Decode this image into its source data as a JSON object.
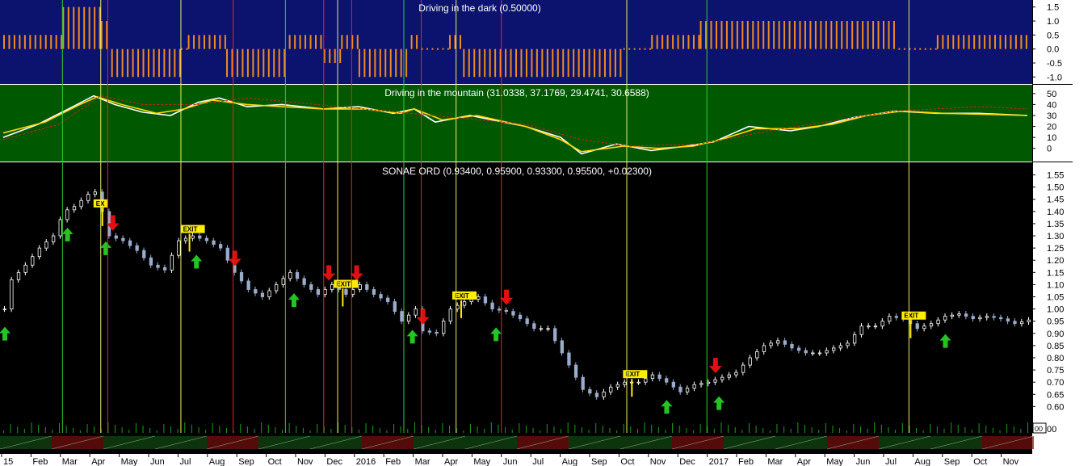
{
  "colors": {
    "panel1_bg": "#0b136e",
    "panel2_bg": "#005800",
    "panel3_bg": "#000000",
    "oscillator_bar": "#f08a20",
    "fast_line": "#ffffff",
    "slow_line": "#ffd700",
    "dashed_line": "#d42020",
    "up_candle": "#ffffff",
    "down_candle": "#9aaccc",
    "buy_arrow": "#22c522",
    "sell_arrow": "#e01010",
    "exit_label": "#ffee00",
    "buy_line": "#33cc33",
    "sell_line": "#ee2222",
    "exit_line": "#eeee66",
    "volume_bar": "#1aa01a"
  },
  "chart_data": [
    {
      "type": "bar",
      "title": "Driving in the dark (0.50000)",
      "y_ticks": [
        "1.5",
        "1.0",
        "0.5",
        "0.0",
        "-0.5",
        "-1.0"
      ],
      "ylim": [
        -1.25,
        1.75
      ],
      "segments": [
        {
          "from": 0,
          "to": 17,
          "value": 0.5
        },
        {
          "from": 17,
          "to": 28,
          "value": 1.5
        },
        {
          "from": 28,
          "to": 31,
          "value": 1.0
        },
        {
          "from": 31,
          "to": 51,
          "value": -1.0
        },
        {
          "from": 51,
          "to": 53,
          "value": 0.0
        },
        {
          "from": 53,
          "to": 64,
          "value": 0.5
        },
        {
          "from": 64,
          "to": 82,
          "value": -1.0
        },
        {
          "from": 82,
          "to": 92,
          "value": 0.5
        },
        {
          "from": 92,
          "to": 97,
          "value": -0.5
        },
        {
          "from": 97,
          "to": 102,
          "value": 0.5
        },
        {
          "from": 102,
          "to": 117,
          "value": -1.0
        },
        {
          "from": 117,
          "to": 120,
          "value": 0.5
        },
        {
          "from": 120,
          "to": 128,
          "value": 0.0
        },
        {
          "from": 128,
          "to": 132,
          "value": 0.5
        },
        {
          "from": 132,
          "to": 178,
          "value": -1.0
        },
        {
          "from": 178,
          "to": 186,
          "value": 0.0
        },
        {
          "from": 186,
          "to": 200,
          "value": 0.5
        },
        {
          "from": 200,
          "to": 257,
          "value": 1.0
        },
        {
          "from": 257,
          "to": 268,
          "value": 0.0
        },
        {
          "from": 268,
          "to": 294,
          "value": 0.5
        }
      ]
    },
    {
      "type": "line",
      "title": "Driving in the mountain (31.0338, 37.1769, 29.4741, 30.6588)",
      "y_ticks": [
        "50",
        "40",
        "30",
        "20",
        "10",
        "0"
      ],
      "ylim": [
        -12,
        58
      ],
      "series": [
        {
          "style": "fast",
          "points": [
            [
              0,
              10
            ],
            [
              10,
              22
            ],
            [
              20,
              38
            ],
            [
              26,
              48
            ],
            [
              32,
              40
            ],
            [
              40,
              33
            ],
            [
              48,
              30
            ],
            [
              56,
              42
            ],
            [
              62,
              46
            ],
            [
              70,
              38
            ],
            [
              80,
              40
            ],
            [
              92,
              36
            ],
            [
              102,
              38
            ],
            [
              112,
              32
            ],
            [
              118,
              36
            ],
            [
              124,
              24
            ],
            [
              134,
              30
            ],
            [
              150,
              20
            ],
            [
              160,
              10
            ],
            [
              166,
              -5
            ],
            [
              176,
              4
            ],
            [
              186,
              -2
            ],
            [
              196,
              2
            ],
            [
              204,
              6
            ],
            [
              214,
              20
            ],
            [
              226,
              16
            ],
            [
              234,
              20
            ],
            [
              244,
              28
            ],
            [
              256,
              34
            ],
            [
              268,
              32
            ],
            [
              280,
              32
            ],
            [
              294,
              30
            ]
          ]
        },
        {
          "style": "slow",
          "points": [
            [
              0,
              14
            ],
            [
              12,
              24
            ],
            [
              22,
              40
            ],
            [
              27,
              47
            ],
            [
              34,
              40
            ],
            [
              44,
              32
            ],
            [
              52,
              36
            ],
            [
              60,
              44
            ],
            [
              70,
              40
            ],
            [
              80,
              38
            ],
            [
              92,
              36
            ],
            [
              104,
              36
            ],
            [
              114,
              32
            ],
            [
              118,
              36
            ],
            [
              126,
              26
            ],
            [
              136,
              30
            ],
            [
              150,
              20
            ],
            [
              160,
              8
            ],
            [
              166,
              -3
            ],
            [
              178,
              2
            ],
            [
              188,
              0
            ],
            [
              198,
              2
            ],
            [
              206,
              8
            ],
            [
              216,
              18
            ],
            [
              228,
              18
            ],
            [
              238,
              22
            ],
            [
              248,
              30
            ],
            [
              258,
              34
            ],
            [
              270,
              32
            ],
            [
              282,
              31
            ],
            [
              294,
              30
            ]
          ]
        },
        {
          "style": "dashed",
          "points": [
            [
              0,
              8
            ],
            [
              16,
              22
            ],
            [
              28,
              48
            ],
            [
              40,
              40
            ],
            [
              56,
              40
            ],
            [
              70,
              46
            ],
            [
              90,
              40
            ],
            [
              110,
              34
            ],
            [
              130,
              28
            ],
            [
              150,
              22
            ],
            [
              166,
              8
            ],
            [
              180,
              2
            ],
            [
              200,
              4
            ],
            [
              220,
              16
            ],
            [
              240,
              26
            ],
            [
              256,
              34
            ],
            [
              280,
              38
            ],
            [
              294,
              36
            ]
          ]
        }
      ]
    },
    {
      "type": "candlestick",
      "title": "SONAE ORD (0.93400, 0.95900, 0.93300, 0.95500, +0.02300)",
      "y_ticks": [
        "1.55",
        "1.50",
        "1.45",
        "1.40",
        "1.35",
        "1.30",
        "1.25",
        "1.20",
        "1.15",
        "1.10",
        "1.05",
        "1.00",
        "0.95",
        "0.90",
        "0.85",
        "0.80",
        "0.75",
        "0.70",
        "0.65",
        "0.60"
      ],
      "ylim": [
        0.545,
        1.575
      ],
      "x_labels": [
        "15",
        "Feb",
        "Mar",
        "Apr",
        "May",
        "Jun",
        "Jul",
        "Aug",
        "Sep",
        "Oct",
        "Nov",
        "Dec",
        "2016",
        "Feb",
        "Mar",
        "Apr",
        "May",
        "Jun",
        "Jul",
        "Aug",
        "Sep",
        "Oct",
        "Nov",
        "Dec",
        "2017",
        "Feb",
        "Mar",
        "Apr",
        "May",
        "Jun",
        "Jul",
        "Aug",
        "Sep",
        "Oct",
        "Nov"
      ],
      "close_path": [
        [
          0,
          1.0
        ],
        [
          2,
          1.12
        ],
        [
          6,
          1.18
        ],
        [
          10,
          1.25
        ],
        [
          14,
          1.3
        ],
        [
          17,
          1.4
        ],
        [
          20,
          1.42
        ],
        [
          24,
          1.47
        ],
        [
          26,
          1.48
        ],
        [
          28,
          1.4
        ],
        [
          30,
          1.3
        ],
        [
          34,
          1.28
        ],
        [
          38,
          1.24
        ],
        [
          42,
          1.18
        ],
        [
          46,
          1.16
        ],
        [
          50,
          1.28
        ],
        [
          54,
          1.3
        ],
        [
          58,
          1.28
        ],
        [
          62,
          1.25
        ],
        [
          66,
          1.15
        ],
        [
          70,
          1.08
        ],
        [
          74,
          1.05
        ],
        [
          78,
          1.1
        ],
        [
          82,
          1.15
        ],
        [
          86,
          1.1
        ],
        [
          90,
          1.06
        ],
        [
          94,
          1.1
        ],
        [
          98,
          1.06
        ],
        [
          102,
          1.1
        ],
        [
          106,
          1.06
        ],
        [
          110,
          1.03
        ],
        [
          114,
          0.95
        ],
        [
          118,
          1.0
        ],
        [
          120,
          0.91
        ],
        [
          124,
          0.9
        ],
        [
          128,
          1.0
        ],
        [
          132,
          1.03
        ],
        [
          136,
          1.05
        ],
        [
          140,
          1.0
        ],
        [
          144,
          0.99
        ],
        [
          148,
          0.96
        ],
        [
          152,
          0.92
        ],
        [
          156,
          0.92
        ],
        [
          160,
          0.82
        ],
        [
          164,
          0.72
        ],
        [
          166,
          0.67
        ],
        [
          170,
          0.64
        ],
        [
          174,
          0.68
        ],
        [
          178,
          0.7
        ],
        [
          182,
          0.7
        ],
        [
          186,
          0.73
        ],
        [
          190,
          0.7
        ],
        [
          194,
          0.66
        ],
        [
          198,
          0.69
        ],
        [
          202,
          0.7
        ],
        [
          206,
          0.72
        ],
        [
          210,
          0.74
        ],
        [
          214,
          0.8
        ],
        [
          218,
          0.85
        ],
        [
          222,
          0.87
        ],
        [
          226,
          0.84
        ],
        [
          230,
          0.82
        ],
        [
          234,
          0.82
        ],
        [
          238,
          0.84
        ],
        [
          242,
          0.86
        ],
        [
          246,
          0.93
        ],
        [
          250,
          0.93
        ],
        [
          254,
          0.97
        ],
        [
          258,
          0.96
        ],
        [
          262,
          0.92
        ],
        [
          266,
          0.94
        ],
        [
          270,
          0.97
        ],
        [
          274,
          0.98
        ],
        [
          278,
          0.96
        ],
        [
          282,
          0.97
        ],
        [
          286,
          0.96
        ],
        [
          290,
          0.94
        ],
        [
          294,
          0.955
        ]
      ],
      "buy_signals": [
        0,
        18,
        29,
        55,
        83,
        117,
        141,
        190,
        205,
        270
      ],
      "sell_signals": [
        31,
        66,
        93,
        101,
        120,
        144,
        204
      ],
      "exit_signals": [
        {
          "x": 28,
          "label": "EX"
        },
        {
          "x": 53,
          "label": "EXIT"
        },
        {
          "x": 97,
          "label": "EXIT"
        },
        {
          "x": 131,
          "label": "EXIT"
        },
        {
          "x": 180,
          "label": "EXIT"
        },
        {
          "x": 260,
          "label": "EXIT"
        }
      ],
      "volume_ticks": [
        "00",
        "00"
      ]
    }
  ],
  "vertical_lines": [
    {
      "x": 17,
      "kind": "buy"
    },
    {
      "x": 28,
      "kind": "exit"
    },
    {
      "x": 30,
      "kind": "sell"
    },
    {
      "x": 51,
      "kind": "exit"
    },
    {
      "x": 66,
      "kind": "sell"
    },
    {
      "x": 81,
      "kind": "buy"
    },
    {
      "x": 92,
      "kind": "sell"
    },
    {
      "x": 96,
      "kind": "exit"
    },
    {
      "x": 100,
      "kind": "sell"
    },
    {
      "x": 115,
      "kind": "buy"
    },
    {
      "x": 120,
      "kind": "sell"
    },
    {
      "x": 130,
      "kind": "exit"
    },
    {
      "x": 143,
      "kind": "sell"
    },
    {
      "x": 179,
      "kind": "exit"
    },
    {
      "x": 202,
      "kind": "buy"
    },
    {
      "x": 260,
      "kind": "exit"
    }
  ]
}
